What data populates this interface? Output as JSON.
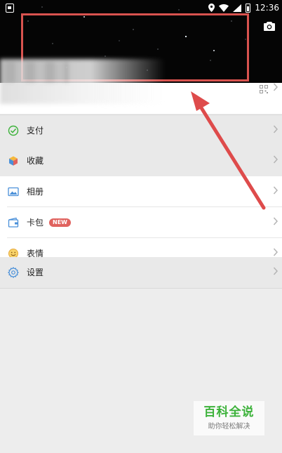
{
  "statusbar": {
    "time": "12:36"
  },
  "menu": {
    "group1": [
      {
        "label": "支付",
        "icon": "wallet-check-icon"
      }
    ],
    "group2": [
      {
        "label": "收藏",
        "icon": "cube-icon"
      }
    ],
    "group3": [
      {
        "label": "相册",
        "icon": "album-icon"
      },
      {
        "label": "卡包",
        "icon": "card-wallet-icon",
        "badge": "NEW"
      },
      {
        "label": "表情",
        "icon": "smiley-icon"
      }
    ],
    "group4": [
      {
        "label": "设置",
        "icon": "gear-icon"
      }
    ]
  },
  "watermark": {
    "title": "百科全说",
    "subtitle": "助你轻松解决"
  },
  "colors": {
    "highlight": "#d9534f",
    "accent_green": "#3cb23a",
    "badge": "#e0625e",
    "icon_blue": "#4a90d9"
  }
}
